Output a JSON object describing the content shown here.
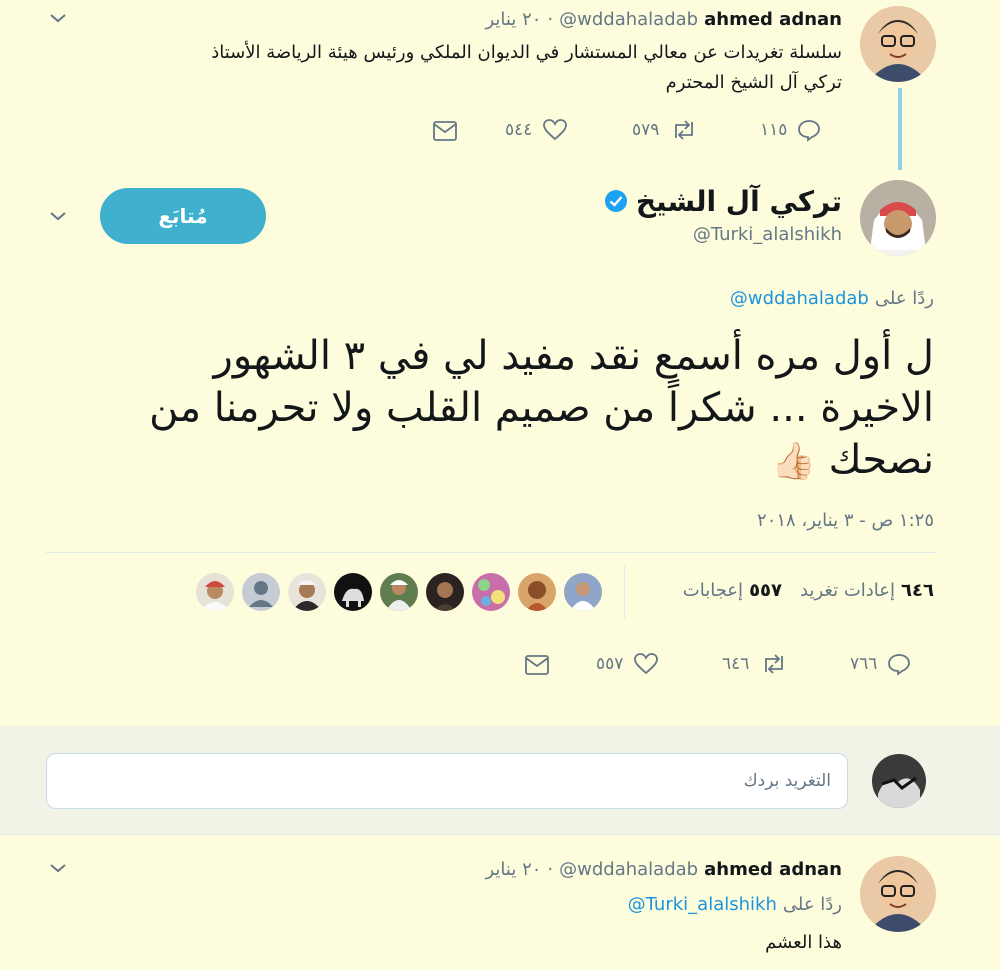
{
  "tweet1": {
    "name": "ahmed adnan",
    "handle": "@wddahaladab",
    "date": "٢٠ يناير",
    "text_line1": "سلسلة تغريدات عن معالي المستشار في الديوان الملكي ورئيس هيئة الرياضة الأستاذ",
    "text_line2": "تركي آل الشيخ المحترم",
    "replies": "١١٥",
    "retweets": "٥٧٩",
    "likes": "٥٤٤"
  },
  "main_tweet": {
    "name": "تركي آل الشيخ",
    "handle": "@Turki_alalshikh",
    "follow_label": "مُتابَع",
    "reply_to_prefix": "ردًا على",
    "reply_to_handle": "@wddahaladab",
    "text_line1": "ل أول مره أسمع نقد مفيد لي في ٣ الشهور",
    "text_line2": "الاخيرة ... شكراً من صميم القلب ولا تحرمنا من",
    "text_line3": "نصحك",
    "emoji": "👍🏻",
    "timestamp": "١:٢٥ ص - ٣ يناير، ٢٠١٨",
    "retweets_count": "٦٤٦",
    "retweets_label": "إعادات تغريد",
    "likes_count": "٥٥٧",
    "likes_label": "إعجابات",
    "action_replies": "٧٦٦",
    "action_retweets": "٦٤٦",
    "action_likes": "٥٥٧"
  },
  "reply_composer": {
    "placeholder": "التغريد بردك"
  },
  "tweet3": {
    "name": "ahmed adnan",
    "handle": "@wddahaladab",
    "date": "٢٠ يناير",
    "reply_to_prefix": "ردًا على",
    "reply_to_handle": "@Turki_alalshikh",
    "text": "هذا العشم"
  },
  "colors": {
    "background": "#fdfcdc",
    "accent": "#1b95e0",
    "follow_button": "#3fb1cf",
    "thread_line": "#8fd3e0",
    "verified": "#1da1f2"
  }
}
